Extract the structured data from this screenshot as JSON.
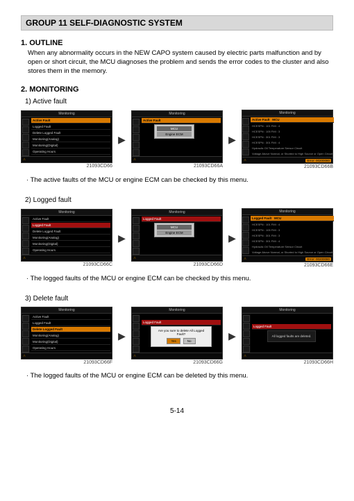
{
  "header": "GROUP  11  SELF-DIAGNOSTIC SYSTEM",
  "outline": {
    "title": "1. OUTLINE",
    "text": "When any abnormality occurs in the NEW CAPO system caused by electric parts malfunction and by open or short circuit, the MCU diagnoses the problem and sends the error codes to the cluster and also stores them in the memory."
  },
  "monitoring": {
    "title": "2. MONITORING",
    "active": {
      "title": "1) Active fault",
      "note": "The active faults of the MCU or engine ECM can be checked by this menu.",
      "labels": [
        "21093CD66",
        "21093CD66A",
        "21093CD66B"
      ]
    },
    "logged": {
      "title": "2) Logged fault",
      "note": "The logged faults of the MCU or engine ECM can be checked by this menu.",
      "labels": [
        "21093CD66C",
        "21093CD66D",
        "21093CD66E"
      ]
    },
    "delete": {
      "title": "3) Delete fault",
      "note": "The logged faults of the MCU or engine ECM can be deleted by this menu.",
      "labels": [
        "21093CD66F",
        "21093CD66G",
        "21093CD66H"
      ]
    }
  },
  "screens": {
    "titlebar": "Monitoring",
    "menu1": {
      "active": "Active Fault",
      "logged": "Logged Fault",
      "delete": "Delete Logged Fault",
      "monitoring_analog": "Monitoring(Analog)",
      "monitoring_digital": "Monitoring(Digital)",
      "operating": "Operating Hours"
    },
    "popup": {
      "mcu": "MCU",
      "ecm": "Engine ECM"
    },
    "detail": {
      "active_header": "Active Fault",
      "logged_header": "Logged Fault",
      "mcu_tag": "MCU",
      "codes": [
        "HCESPN : 101    FMI : 4",
        "HCESPN : 105    FMI : 3",
        "HCESPN : 301    FMI : 3",
        "HCESPN : 301    FMI : 4"
      ],
      "desc1": "Hydraulic Oil Temperature Sensor Circuit",
      "desc2": "Voltage Above Normal, or Shorted to High Source or Open Circuit"
    },
    "delete_dialog": {
      "question": "Are you sure to delete All Logged Fault?",
      "yes": "Yes",
      "no": "No"
    },
    "deleted_msg": "All logged faults are deleted.",
    "footer_error": "Error: 00200080"
  },
  "page": "5-14"
}
